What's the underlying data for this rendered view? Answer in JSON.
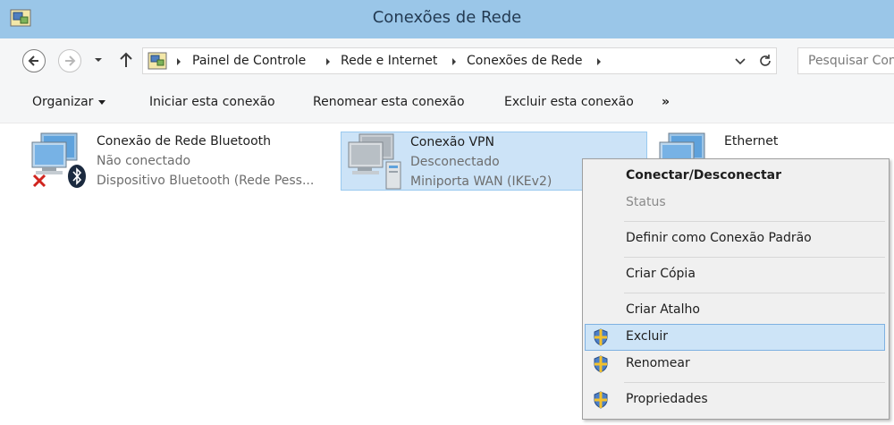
{
  "window": {
    "title": "Conexões de Rede"
  },
  "address": {
    "breadcrumb": [
      "Painel de Controle",
      "Rede e Internet",
      "Conexões de Rede"
    ],
    "search_placeholder": "Pesquisar Con"
  },
  "toolbar": {
    "organize_label": "Organizar",
    "start_label": "Iniciar esta conexão",
    "rename_label": "Renomear esta conexão",
    "delete_label": "Excluir esta conexão",
    "more_label": "»"
  },
  "connections": [
    {
      "name": "Conexão de Rede Bluetooth",
      "status": "Não conectado",
      "device": "Dispositivo Bluetooth (Rede Pess..."
    },
    {
      "name": "Conexão VPN",
      "status": "Desconectado",
      "device": "Miniporta WAN (IKEv2)"
    },
    {
      "name": "Ethernet"
    }
  ],
  "context_menu": {
    "items": [
      {
        "label": "Conectar/Desconectar"
      },
      {
        "label": "Status"
      },
      {
        "label": "Definir como Conexão Padrão"
      },
      {
        "label": "Criar Cópia"
      },
      {
        "label": "Criar Atalho"
      },
      {
        "label": "Excluir"
      },
      {
        "label": "Renomear"
      },
      {
        "label": "Propriedades"
      }
    ]
  },
  "colors": {
    "title_bar": "#9ac6e8",
    "selection": "#cce3f7",
    "menu_hover": "#cde4f7"
  }
}
